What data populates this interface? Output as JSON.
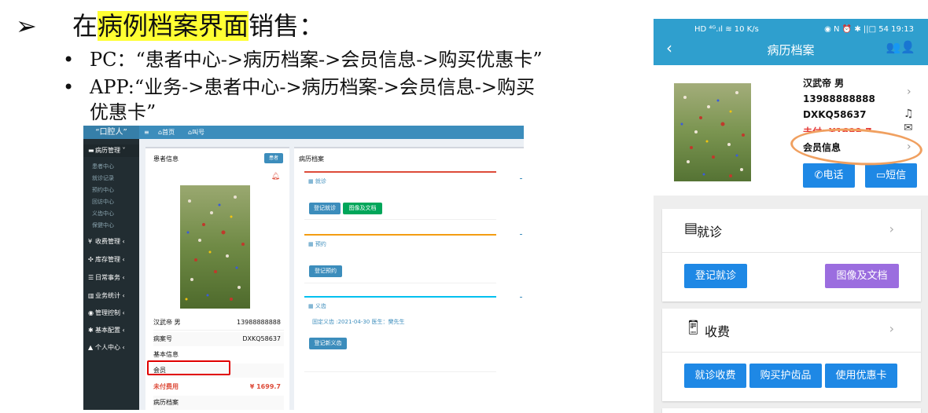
{
  "slide": {
    "arrow": "➢",
    "title_pre": "在",
    "title_highlight": "病例档案界面",
    "title_post": "销售：",
    "bullet_mark": "•",
    "bullet1": "PC：“患者中心->病历档案->会员信息->购买优惠卡”",
    "bullet2_line1": "APP:“业务->患者中心->病历档案->会员信息->购买",
    "bullet2_line2": "优惠卡”"
  },
  "pc": {
    "logo": "“口腔人”",
    "topbar": {
      "menu_icon": "≡",
      "home": "首页",
      "call": "叫号"
    },
    "sidebar": {
      "group_active": "病历管理",
      "sub_items": [
        "患者中心",
        "就诊记录",
        "预约中心",
        "回访中心",
        "义齿中心",
        "保健中心"
      ],
      "groups": [
        "收费管理",
        "库存管理",
        "日常事务",
        "业务统计",
        "管理控制",
        "基本配置",
        "个人中心"
      ]
    },
    "left_panel": {
      "header": "患者信息",
      "patient_button": "患者",
      "name": "汉武帝 男",
      "phone": "13988888888",
      "record_label": "病案号",
      "record_no": "DXKQ58637",
      "basic_info": "基本信息",
      "member": "会员",
      "unpaid_label": "未付费用",
      "unpaid_value": "¥ 1699.7",
      "history": "病历档案"
    },
    "right_panel": {
      "header": "病历档案",
      "visit_title": "就诊",
      "visit_btn1": "登记就诊",
      "visit_btn2": "图像及文档",
      "appt_title": "预约",
      "appt_btn": "登记预约",
      "denture_title": "义齿",
      "denture_record": "固定义齿 :2021-04-30 医生：樊先生",
      "denture_btn": "登记新义齿"
    }
  },
  "phone": {
    "status_left": "HD ⁴ᴳ.ıl ≋ 10 K/s",
    "status_right": "◉ N ⏰ ✱ ||□ 54 19:13",
    "title": "病历档案",
    "back": "‹",
    "users_icon": "👥👤",
    "name": "汉武帝 男",
    "phone": "13988888888",
    "record_no": "DXKQ58637",
    "unpaid": "未付: ¥1699.7",
    "member_info": "会员信息",
    "call_btn": "电话",
    "sms_btn": "短信",
    "visit_title": "就诊",
    "visit_btn1": "登记就诊",
    "visit_btn2": "图像及文档",
    "fee_title": "收费",
    "fee_btn1": "就诊收费",
    "fee_btn2": "购买护齿品",
    "fee_btn3": "使用优惠卡",
    "colors": {
      "header": "#2f9fce",
      "button": "#1e88e5",
      "purple": "#9b6ddf",
      "annotation": "#f0a060"
    }
  }
}
